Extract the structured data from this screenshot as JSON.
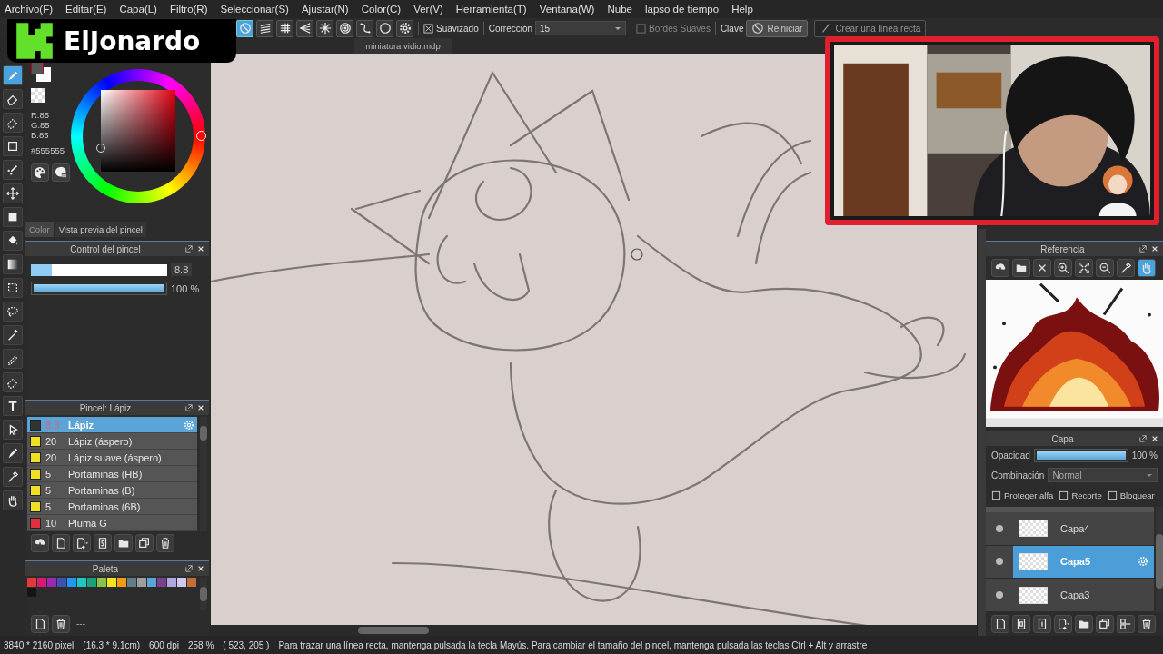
{
  "menu": [
    "Archivo(F)",
    "Editar(E)",
    "Capa(L)",
    "Filtro(R)",
    "Seleccionar(S)",
    "Ajustar(N)",
    "Color(C)",
    "Ver(V)",
    "Herramienta(T)",
    "Ventana(W)",
    "Nube",
    "lapso de tiempo",
    "Help"
  ],
  "toolbar": {
    "rulers": [
      {
        "kind": "none",
        "selected": true
      },
      {
        "kind": "parallel",
        "selected": false
      },
      {
        "kind": "grid",
        "selected": false
      },
      {
        "kind": "perspective",
        "selected": false
      },
      {
        "kind": "radial",
        "selected": false
      },
      {
        "kind": "concentric",
        "selected": false
      },
      {
        "kind": "curve",
        "selected": false
      },
      {
        "kind": "ellipse",
        "selected": false
      },
      {
        "kind": "settings",
        "selected": false
      }
    ],
    "smoothing": {
      "label": "Suavizado",
      "checked": true
    },
    "correction": {
      "label": "Corrección",
      "value": "15"
    },
    "soft_edges": {
      "label": "Bordes Suaves",
      "checked": false
    },
    "key_label": "Clave",
    "reset_button": "Reiniciar",
    "line_button": "Crear una línea recta"
  },
  "overlay_logo": {
    "name": "ElJonardo"
  },
  "tools": [
    {
      "kind": "brush",
      "selected": true
    },
    {
      "kind": "eraser",
      "selected": false
    },
    {
      "kind": "sel-eraser",
      "selected": false
    },
    {
      "kind": "rect",
      "selected": false
    },
    {
      "kind": "dotpen",
      "selected": false
    },
    {
      "kind": "move",
      "selected": false
    },
    {
      "kind": "fillrect",
      "selected": false
    },
    {
      "kind": "bucket",
      "selected": false
    },
    {
      "kind": "gradient",
      "selected": false
    },
    {
      "kind": "selrect",
      "selected": false
    },
    {
      "kind": "lasso",
      "selected": false
    },
    {
      "kind": "wand",
      "selected": false
    },
    {
      "kind": "selpen",
      "selected": false
    },
    {
      "kind": "sel-eraser",
      "selected": false
    },
    {
      "kind": "text",
      "selected": false
    },
    {
      "kind": "operate",
      "selected": false
    },
    {
      "kind": "knife",
      "selected": false
    },
    {
      "kind": "dropper",
      "selected": false
    },
    {
      "kind": "hand",
      "selected": false
    }
  ],
  "color_panel": {
    "rgb": [
      "R:85",
      "G:85",
      "B:85"
    ],
    "hex": "#555555",
    "tabs": [
      {
        "label": "Color",
        "selected": true
      },
      {
        "label": "Vista previa del pincel",
        "selected": false
      }
    ]
  },
  "brush_control": {
    "title": "Control del pincel",
    "size": {
      "level": 0.15,
      "reading": "8.8"
    },
    "opacity": {
      "level": 1.0,
      "reading": "100 %"
    }
  },
  "brushes": {
    "title": "Pincel: Lápiz",
    "items": [
      {
        "size": "8.8",
        "name": "Lápiz",
        "color": "#333333",
        "selected": true
      },
      {
        "size": "20",
        "name": "Lápiz (áspero)",
        "color": "#f0e020",
        "selected": false
      },
      {
        "size": "20",
        "name": "Lápiz suave (áspero)",
        "color": "#f0e020",
        "selected": false
      },
      {
        "size": "5",
        "name": "Portaminas (HB)",
        "color": "#f0e020",
        "selected": false
      },
      {
        "size": "5",
        "name": "Portaminas (B)",
        "color": "#f0e020",
        "selected": false
      },
      {
        "size": "5",
        "name": "Portaminas (6B)",
        "color": "#f0e020",
        "selected": false
      },
      {
        "size": "10",
        "name": "Pluma G",
        "color": "#e03040",
        "selected": false
      }
    ],
    "toolbar": [
      {
        "kind": "cloud"
      },
      {
        "kind": "new"
      },
      {
        "kind": "add"
      },
      {
        "kind": "script"
      },
      {
        "kind": "folder"
      },
      {
        "kind": "duplicate"
      },
      {
        "kind": "delete"
      }
    ]
  },
  "palette": {
    "title": "Paleta",
    "colors": [
      {
        "color": "#e03a3a"
      },
      {
        "color": "#d81b72"
      },
      {
        "color": "#9c27b0"
      },
      {
        "color": "#3f51b5"
      },
      {
        "color": "#2196f3"
      },
      {
        "color": "#1ec7c7"
      },
      {
        "color": "#1aa37a"
      },
      {
        "color": "#8bc34a"
      },
      {
        "color": "#f2e41f"
      },
      {
        "color": "#f39c12"
      },
      {
        "color": "#607d8b"
      },
      {
        "color": "#9e9e9e"
      },
      {
        "color": "#5ba4d8"
      },
      {
        "color": "#7b3f8c"
      },
      {
        "color": "#b0a8e0"
      },
      {
        "color": "#d0c8f0"
      },
      {
        "color": "#c07038"
      },
      {
        "color": "#151515"
      }
    ],
    "footer_text": "---"
  },
  "document_tab": "miniatura vidio.mdp",
  "reference": {
    "title": "Referencia",
    "toolbar": [
      {
        "kind": "cloud",
        "selected": false
      },
      {
        "kind": "folder",
        "selected": false
      },
      {
        "kind": "close",
        "selected": false
      },
      {
        "kind": "zoomin",
        "selected": false
      },
      {
        "kind": "fit",
        "selected": false
      },
      {
        "kind": "zoomout",
        "selected": false
      },
      {
        "kind": "dropper",
        "selected": false
      },
      {
        "kind": "hand",
        "selected": true
      }
    ]
  },
  "layers": {
    "title": "Capa",
    "opacity": {
      "label": "Opacidad",
      "level": 1.0,
      "reading": "100 %"
    },
    "blend": {
      "label": "Combinación",
      "value": "Normal"
    },
    "options": [
      {
        "label": "Proteger alfa",
        "checked": false
      },
      {
        "label": "Recorte",
        "checked": false
      },
      {
        "label": "Bloquear",
        "checked": false
      }
    ],
    "items": [
      {
        "name": "Capa4",
        "selected": false
      },
      {
        "name": "Capa5",
        "selected": true
      },
      {
        "name": "Capa3",
        "selected": false
      }
    ],
    "toolbar": [
      {
        "kind": "new"
      },
      {
        "kind": "page8"
      },
      {
        "kind": "page1"
      },
      {
        "kind": "add"
      },
      {
        "kind": "folder"
      },
      {
        "kind": "duplicate"
      },
      {
        "kind": "merge"
      },
      {
        "kind": "delete"
      }
    ]
  },
  "status": {
    "size": "3840 * 2160 pixel",
    "physical": "(16.3 * 9.1cm)",
    "dpi": "600 dpi",
    "zoom": "258 %",
    "cursor": "( 523, 205 )",
    "hint": "Para trazar una línea recta, mantenga pulsada la tecla Mayús. Para cambiar el tamaño del pincel, mantenga pulsada las teclas Ctrl + Alt y arrastre"
  }
}
